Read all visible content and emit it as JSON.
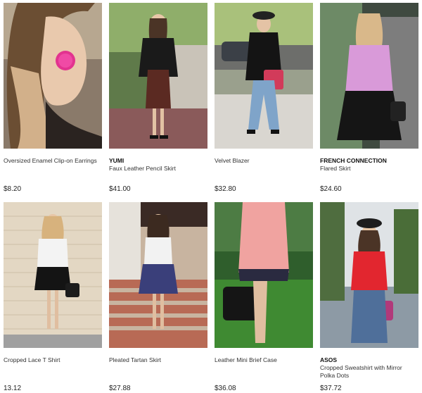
{
  "products": [
    {
      "brand": "",
      "name": "Oversized Enamel Clip-on Earrings",
      "price": "$8.20"
    },
    {
      "brand": "YUMI",
      "name": "Faux Leather Pencil Skirt",
      "price": "$41.00"
    },
    {
      "brand": "",
      "name": "Velvet Blazer",
      "price": "$32.80"
    },
    {
      "brand": "FRENCH CONNECTION",
      "name": "Flared Skirt",
      "price": "$24.60"
    },
    {
      "brand": "",
      "name": "Cropped Lace T Shirt",
      "price": "13.12"
    },
    {
      "brand": "",
      "name": "Pleated Tartan Skirt",
      "price": "$27.88"
    },
    {
      "brand": "",
      "name": "Leather Mini Brief Case",
      "price": "$36.08"
    },
    {
      "brand": "ASOS",
      "name": "Cropped Sweatshirt with Mirror Polka Dots",
      "price": "$37.72"
    }
  ]
}
